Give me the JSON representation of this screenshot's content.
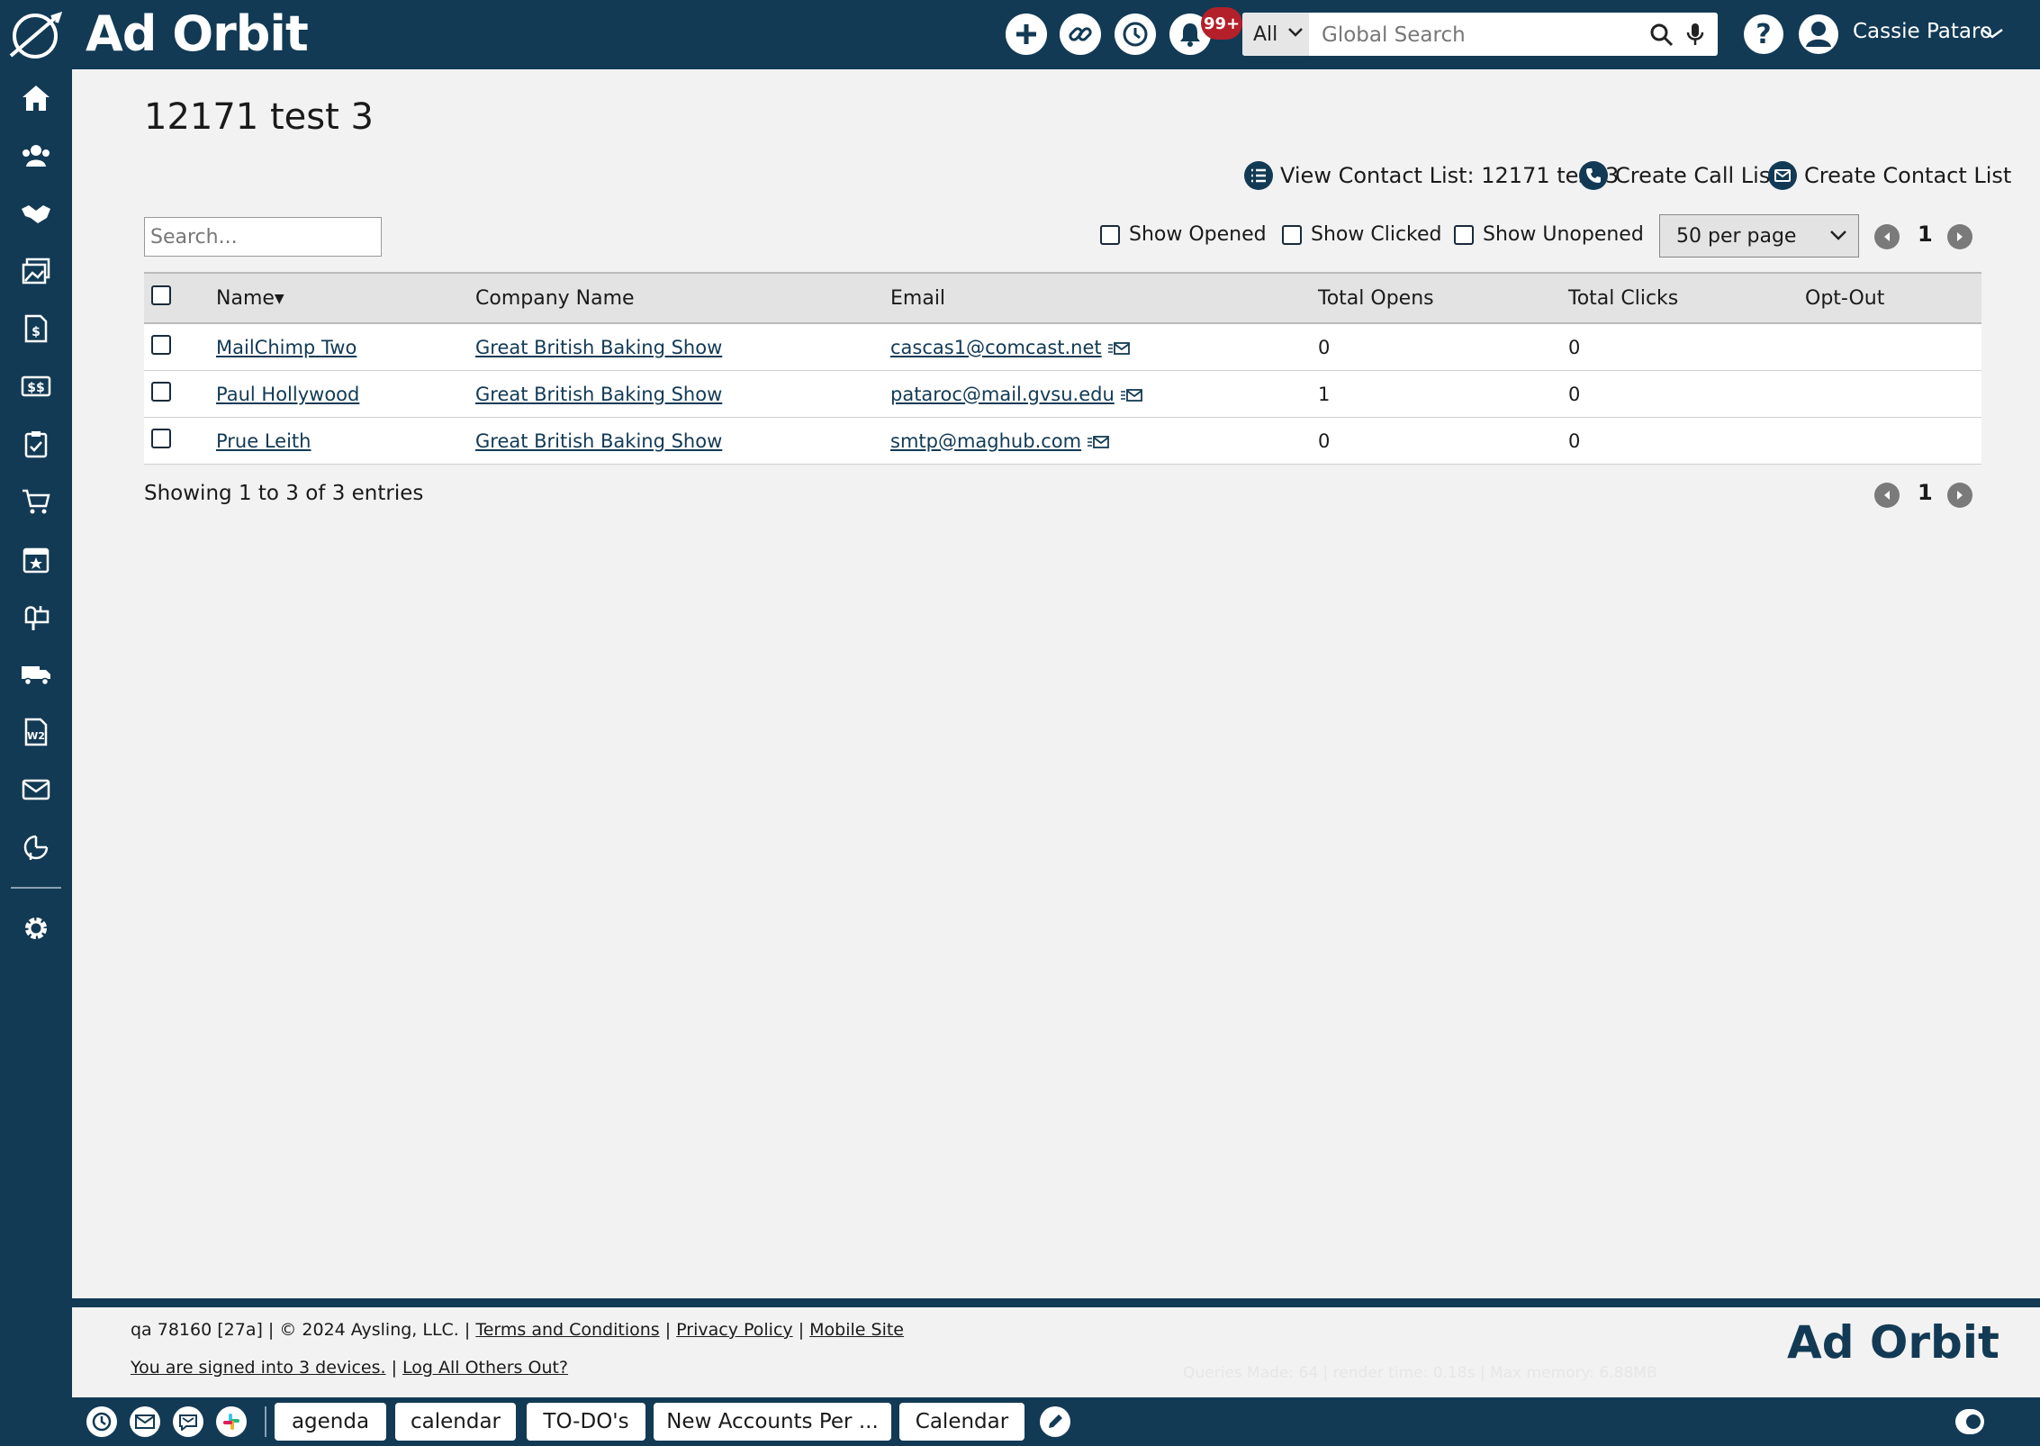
{
  "app": {
    "logo_text": "Ad Orbit"
  },
  "topbar": {
    "notification_count": "99+",
    "search_scope": "All",
    "search_placeholder": "Global Search",
    "user_name": "Cassie Pataro"
  },
  "page": {
    "title": "12171 test 3",
    "actions": {
      "view_contact_list": "View Contact List: 12171 test 3",
      "create_call_list": "Create Call List",
      "create_contact_list": "Create Contact List"
    },
    "search_placeholder": "Search...",
    "filters": {
      "show_opened": "Show Opened",
      "show_clicked": "Show Clicked",
      "show_unopened": "Show Unopened"
    },
    "per_page": "50 per page",
    "current_page": "1",
    "columns": {
      "name": "Name",
      "company": "Company Name",
      "email": "Email",
      "opens": "Total Opens",
      "clicks": "Total Clicks",
      "optout": "Opt-Out"
    },
    "rows": [
      {
        "name": "MailChimp Two",
        "company": "Great British Baking Show",
        "email": "cascas1@comcast.net",
        "opens": "0",
        "clicks": "0",
        "optout": ""
      },
      {
        "name": "Paul Hollywood",
        "company": "Great British Baking Show",
        "email": "pataroc@mail.gvsu.edu",
        "opens": "1",
        "clicks": "0",
        "optout": ""
      },
      {
        "name": "Prue Leith",
        "company": "Great British Baking Show",
        "email": "smtp@maghub.com",
        "opens": "0",
        "clicks": "0",
        "optout": ""
      }
    ],
    "showing": "Showing 1 to 3 of 3 entries"
  },
  "footer": {
    "prefix": "qa 78160 [27a] | © 2024 Aysling, LLC. |",
    "terms": "Terms and Conditions",
    "privacy": "Privacy Policy",
    "mobile": "Mobile Site",
    "signed_in": "You are signed into 3 devices.",
    "log_out_others": "Log All Others Out?",
    "stats": "Queries Made: 64 | render time: 0.18s | Max memory: 6.88MB",
    "logo_text": "Ad Orbit"
  },
  "bottombar": {
    "tabs": [
      "agenda",
      "calendar",
      "TO-DO's",
      "New Accounts Per ...",
      "Calendar"
    ]
  },
  "colors": {
    "nav": "#123a55",
    "badge": "#b3202a",
    "background": "#f2f2f2"
  }
}
